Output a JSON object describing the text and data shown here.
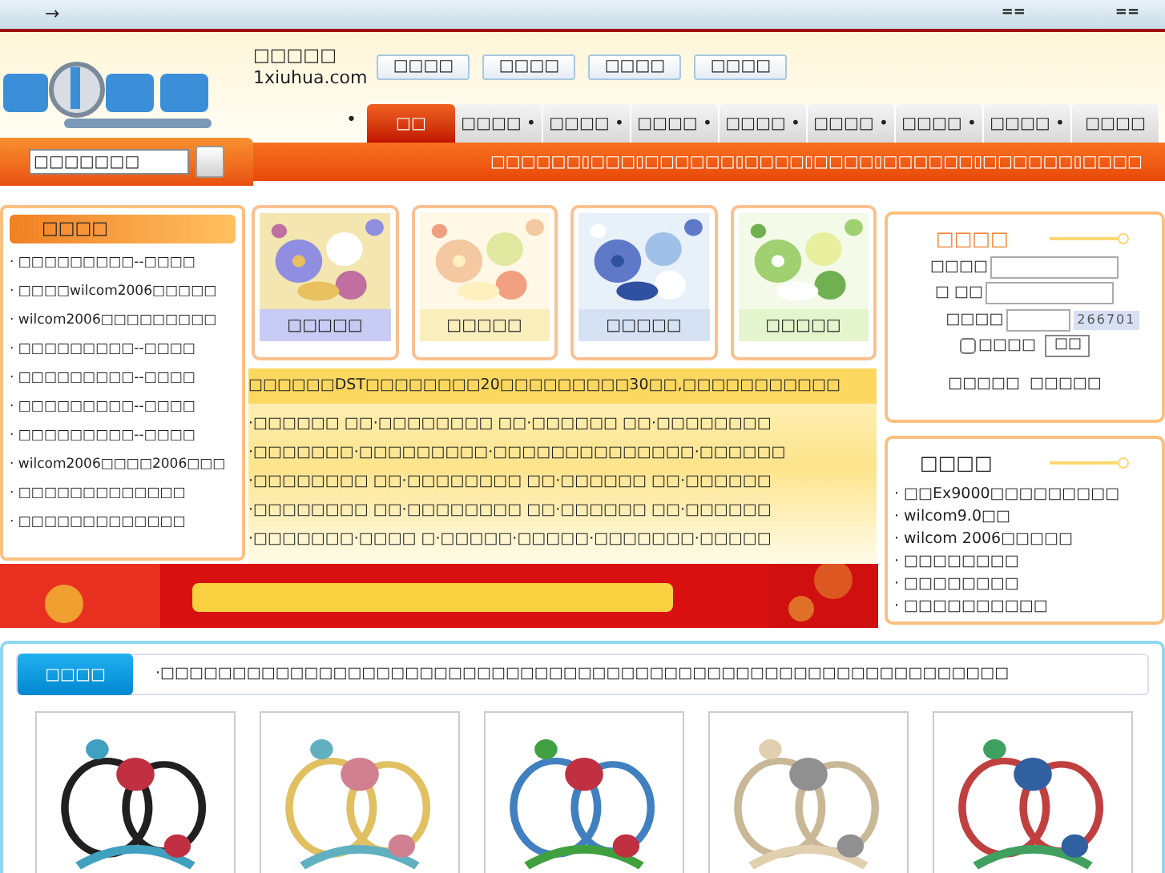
{
  "top_bar": {
    "arrow": "→",
    "links": [
      "==",
      "=="
    ]
  },
  "header": {
    "site_name": "□□□□□",
    "domain": "1xiuhua.com",
    "buttons": [
      "□□□□",
      "□□□□",
      "□□□□",
      "□□□□"
    ]
  },
  "nav": {
    "dot": "•",
    "tabs": [
      {
        "label": "□□",
        "selected": true,
        "dot": false
      },
      {
        "label": "□□□□",
        "selected": false,
        "dot": true
      },
      {
        "label": "□□□□",
        "selected": false,
        "dot": true
      },
      {
        "label": "□□□□",
        "selected": false,
        "dot": true
      },
      {
        "label": "□□□□",
        "selected": false,
        "dot": true
      },
      {
        "label": "□□□□",
        "selected": false,
        "dot": true
      },
      {
        "label": "□□□□",
        "selected": false,
        "dot": true
      },
      {
        "label": "□□□□",
        "selected": false,
        "dot": true
      },
      {
        "label": "□□□□",
        "selected": false,
        "dot": false
      }
    ],
    "search": {
      "value": "□□□□□□□"
    },
    "links": "□□□□□□▯□□□▯□□□□□□▯□□□□▯□□□□▯□□□□□□▯□□□□□□▯□□□□"
  },
  "left_panel": {
    "title": "□□□□",
    "items": [
      "· □□□□□□□□□--□□□□",
      "· □□□□wilcom2006□□□□□",
      "· wilcom2006□□□□□□□□□",
      "· □□□□□□□□□--□□□□",
      "· □□□□□□□□□--□□□□",
      "· □□□□□□□□□--□□□□",
      "· □□□□□□□□□--□□□□",
      "· wilcom2006□□□□2006□□□",
      "· □□□□□□□□□□□□□",
      "· □□□□□□□□□□□□□"
    ]
  },
  "categories": [
    {
      "caption": "□□□□□",
      "color": "#c8ccf4"
    },
    {
      "caption": "□□□□□",
      "color": "#fbeebd"
    },
    {
      "caption": "□□□□□",
      "color": "#d6e2f4"
    },
    {
      "caption": "□□□□□",
      "color": "#e4f4cc"
    }
  ],
  "notice": {
    "heading": "□□□□□□DST□□□□□□□□20□□□□□□□□□30□□,□□□□□□□□□□□",
    "lines": [
      "·□□□□□□ □□·□□□□□□□□ □□·□□□□□□ □□·□□□□□□□□",
      "·□□□□□□□·□□□□□□□□□·□□□□□□□□□□□□□□·□□□□□□",
      "·□□□□□□□□ □□·□□□□□□□□ □□·□□□□□□ □□·□□□□□□",
      "·□□□□□□□□ □□·□□□□□□□□ □□·□□□□□□ □□·□□□□□□",
      "·□□□□□□□·□□□□ □·□□□□□·□□□□□·□□□□□□□·□□□□□"
    ]
  },
  "login": {
    "title": "□□□□",
    "fields": [
      {
        "label": "□□□□"
      },
      {
        "label": "□ □□"
      }
    ],
    "code_label": "□□□□",
    "captcha": "266701",
    "remember": {
      "label": "□□□□",
      "checked": false
    },
    "submit": "□□",
    "links": [
      "□□□□□",
      "□□□□□"
    ]
  },
  "news": {
    "title": "□□□□",
    "items": [
      "· □□Ex9000□□□□□□□□□",
      "· wilcom9.0□□",
      "· wilcom 2006□□□□□",
      "· □□□□□□□□",
      "· □□□□□□□□",
      "· □□□□□□□□□□"
    ]
  },
  "gallery": {
    "tab": "□□□□",
    "marquee": "·□□□□□□□□□□□□□□□□□□□□□□□□□□□□□□□□□□□□□□□□□□□□□□□□□□□□□□□□□□□"
  }
}
